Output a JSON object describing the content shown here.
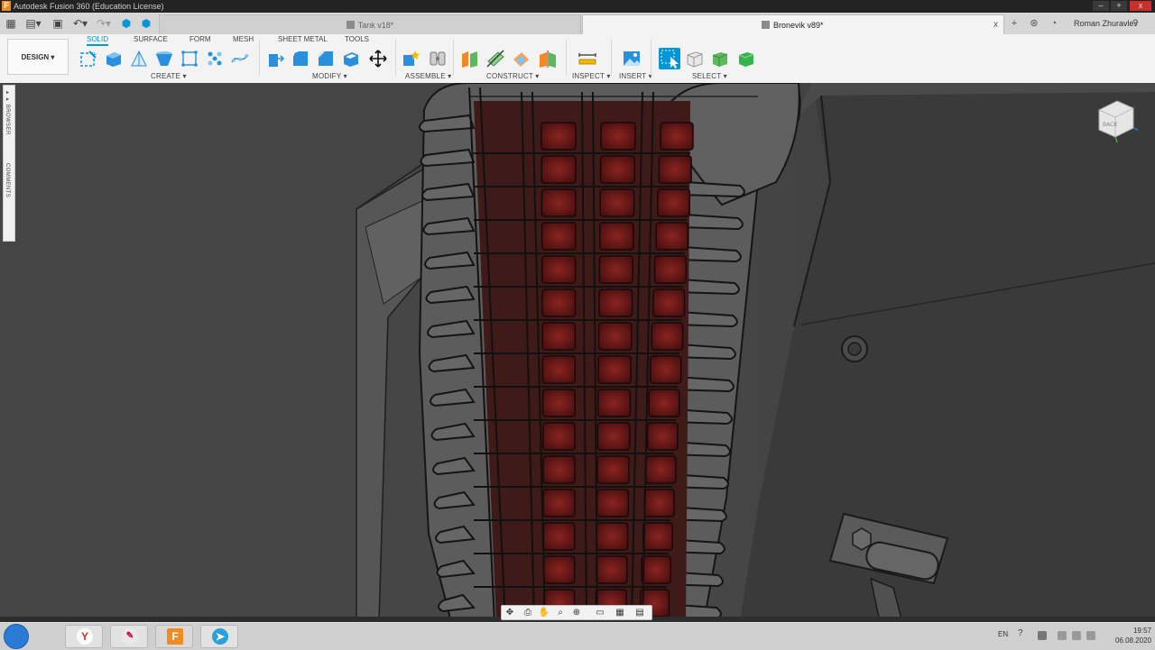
{
  "window": {
    "title": "Autodesk Fusion 360 (Education License)",
    "controls": {
      "minimize": "–",
      "maximize": "+",
      "close": "x"
    }
  },
  "tabs": [
    {
      "label": "Tank v18*",
      "active": false,
      "close": "x"
    },
    {
      "label": "Bronevik v89*",
      "active": true,
      "close": "x"
    }
  ],
  "user": {
    "name": "Roman Zhuravlev"
  },
  "toolbar": {
    "workspace": "DESIGN",
    "workspace_tabs": [
      "SOLID",
      "SURFACE",
      "FORM",
      "MESH",
      "SHEET METAL",
      "TOOLS"
    ],
    "groups": [
      "CREATE",
      "MODIFY",
      "ASSEMBLE",
      "CONSTRUCT",
      "INSPECT",
      "INSERT",
      "SELECT"
    ]
  },
  "sidepanel": {
    "browser": "BROWSER",
    "comments": "COMMENTS"
  },
  "viewcube": {
    "face": "BACK"
  },
  "taskbar": {
    "apps": [
      "yandex-browser",
      "paint",
      "fusion-360",
      "telegram"
    ],
    "language": "EN",
    "time": "19:57",
    "date": "06.08.2020"
  },
  "colors": {
    "accent": "#0696d7",
    "fusion_orange": "#f08a22",
    "model_red": "#6e1a18",
    "viewport_bg": "#3b3b3b"
  }
}
